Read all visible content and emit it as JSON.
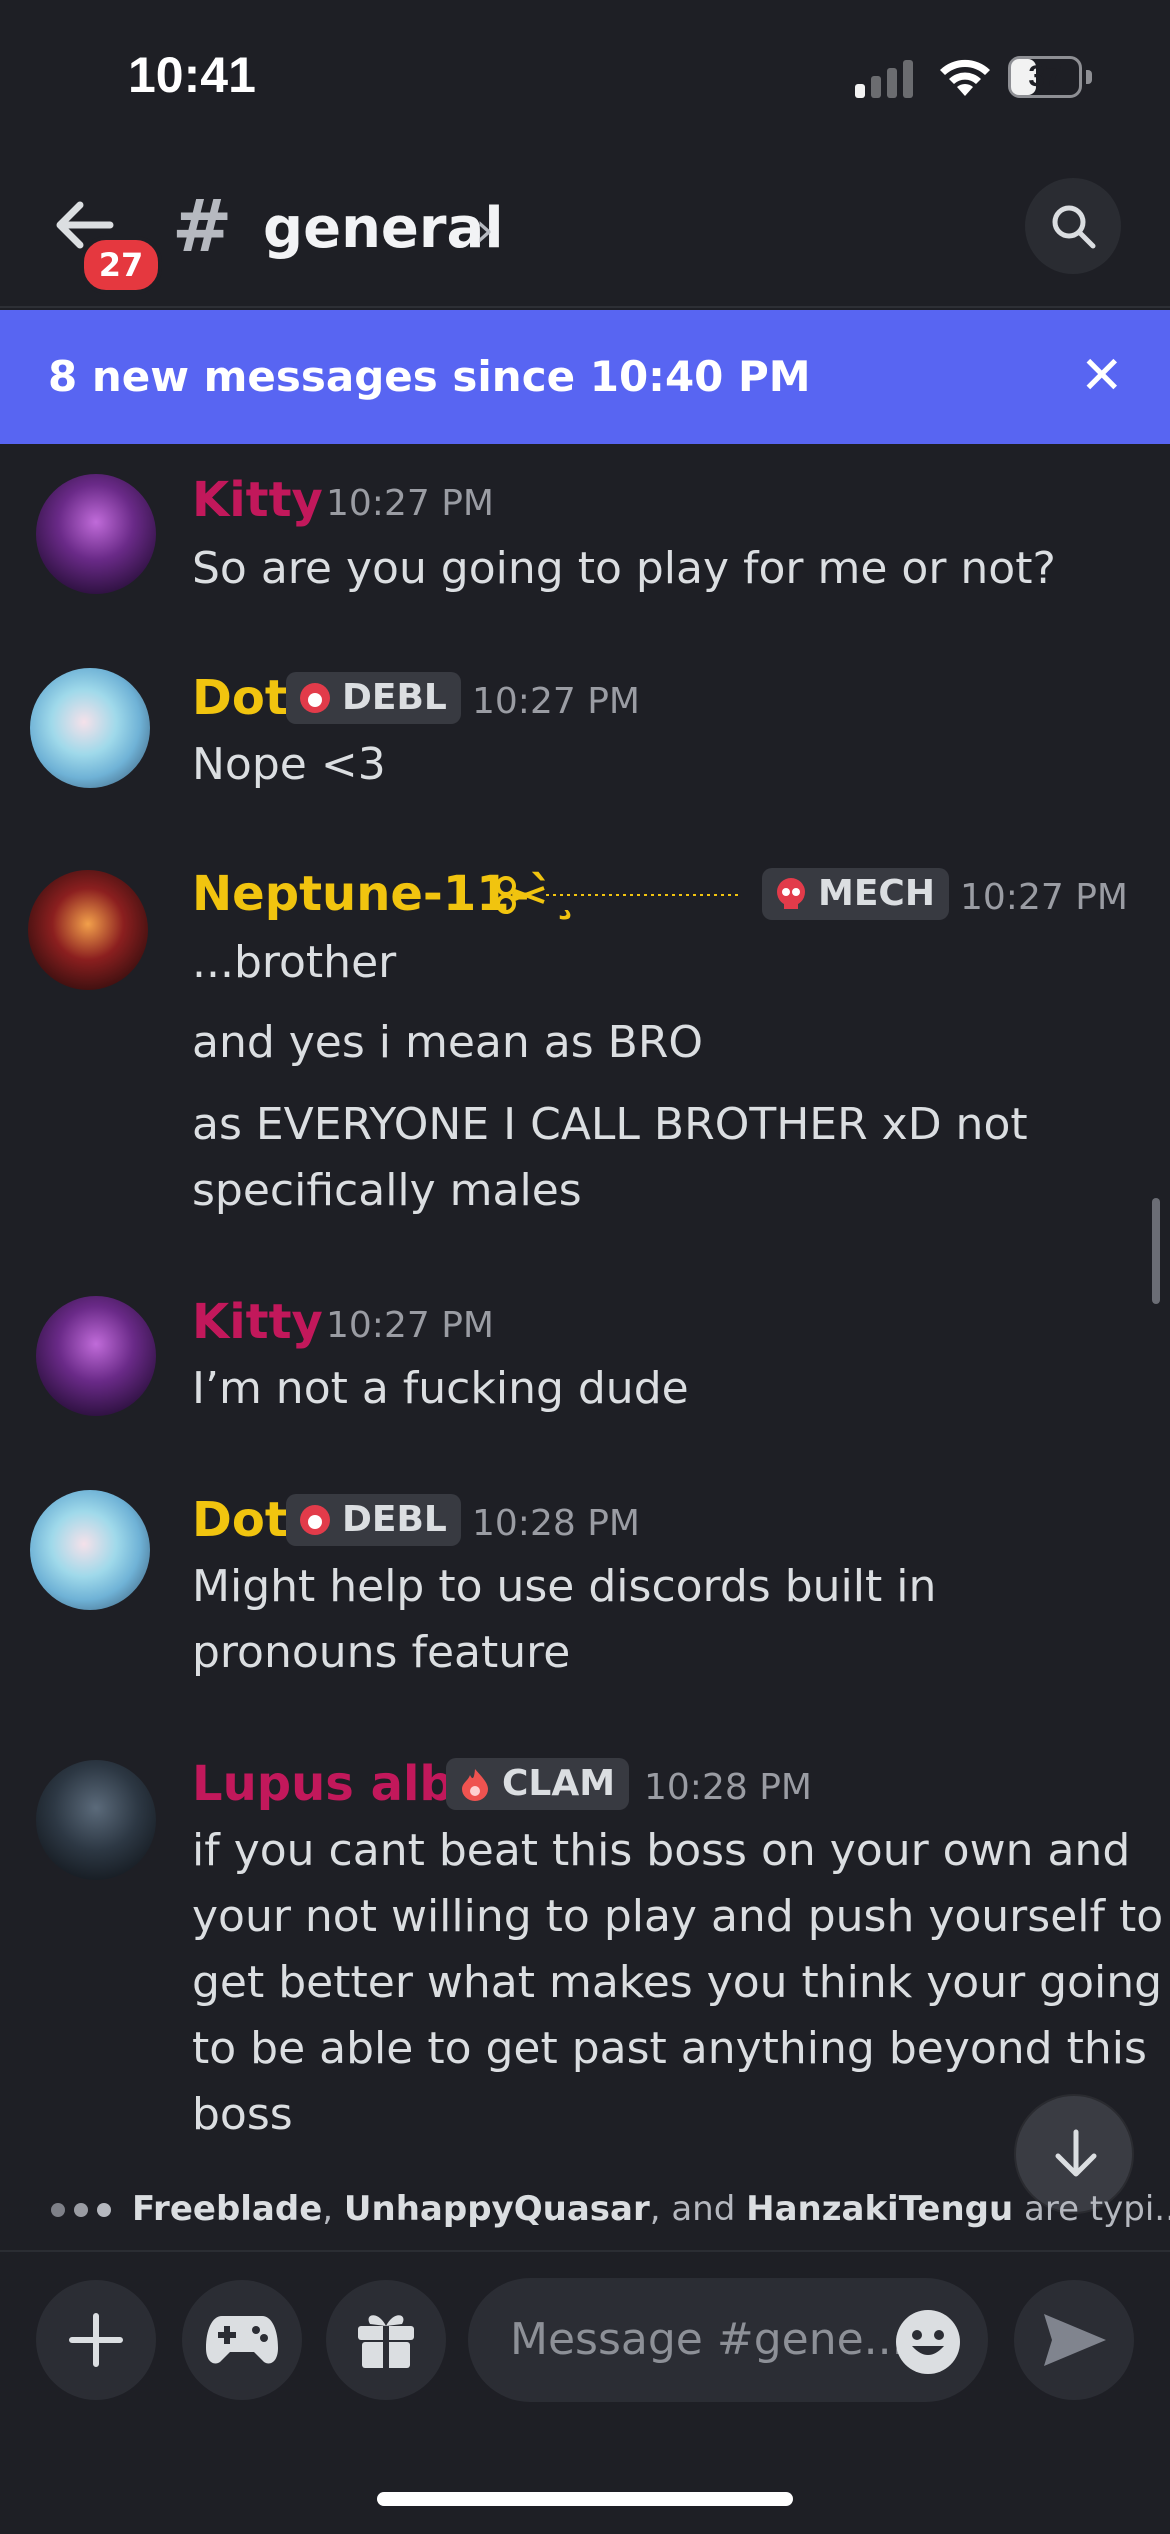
{
  "status": {
    "time": "10:41",
    "battery": "37",
    "battery_level": 0.37
  },
  "header": {
    "badge": "27",
    "hash": "#",
    "channel": "general",
    "chevron": "›"
  },
  "banner": {
    "text": "8 new messages since 10:40 PM",
    "close": "✕"
  },
  "messages": [
    {
      "author": "Kitty",
      "color": "#c2185b",
      "time": "10:27 PM",
      "lines": [
        "So are you going to play for me or not?"
      ]
    },
    {
      "author": "Dot",
      "color": "#f1c40f",
      "tag": "DEBL",
      "time": "10:27 PM",
      "lines": [
        "Nope <3"
      ]
    },
    {
      "author": "Neptune-11-`¸",
      "color": "#f1c40f",
      "tag": "MECH",
      "time": "10:27 PM",
      "lines": [
        "...brother",
        "and yes i mean as BRO",
        "as EVERYONE I CALL BROTHER xD not",
        "specifically males"
      ]
    },
    {
      "author": "Kitty",
      "color": "#c2185b",
      "time": "10:27 PM",
      "lines": [
        "I’m not a fucking dude"
      ]
    },
    {
      "author": "Dot",
      "color": "#f1c40f",
      "tag": "DEBL",
      "time": "10:28 PM",
      "lines": [
        "Might help to use discords built in",
        "pronouns feature"
      ]
    },
    {
      "author": "Lupus alba",
      "color": "#c2185b",
      "tag": "CLAM",
      "time": "10:28 PM",
      "lines": [
        "if you cant beat this boss on your own and",
        "your not willing to play and push yourself to",
        "get better what makes you think your going",
        "to be able to get past anything beyond this",
        "boss"
      ]
    }
  ],
  "typing": {
    "user1": "Freeblade",
    "sep1": ", ",
    "user2": "UnhappyQuasar",
    "sep2": ", and ",
    "user3": "HanzakiTengu",
    "suffix": " are typi..."
  },
  "composer": {
    "placeholder": "Message #gene..."
  }
}
